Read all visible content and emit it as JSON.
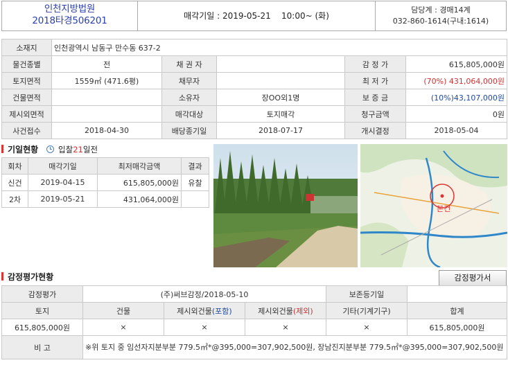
{
  "header": {
    "court": "인천지방법원",
    "case_no": "2018타경506201",
    "sale_label": "매각기일 :",
    "sale_date": "2019-05-21",
    "sale_time": "10:00~",
    "sale_day": "(화)",
    "department": "담당계 : 경매14계",
    "phone": "032-860-1614(구내:1614)"
  },
  "info": {
    "address_label": "소재지",
    "address": "인천광역시 남동구 만수동 637-2",
    "rows": [
      [
        "물건종별",
        "전",
        "채 권 자",
        "",
        "감 정 가",
        "615,805,000원"
      ],
      [
        "토지면적",
        "1559㎡ (471.6평)",
        "채무자",
        "",
        "최 저 가",
        "(70%) 431,064,000원"
      ],
      [
        "건물면적",
        "",
        "소유자",
        "장OO외1명",
        "보 증 금",
        "(10%)43,107,000원"
      ],
      [
        "제시외면적",
        "",
        "매각대상",
        "토지매각",
        "청구금액",
        "0원"
      ],
      [
        "사건접수",
        "2018-04-30",
        "배당종기일",
        "2018-07-17",
        "개시결정",
        "2018-05-04"
      ]
    ]
  },
  "history": {
    "title": "기일현황",
    "bid_prefix": "입찰",
    "bid_days": "21",
    "bid_suffix": "일전",
    "headers": [
      "회차",
      "매각기일",
      "최저매각금액",
      "결과"
    ],
    "rows": [
      [
        "신건",
        "2019-04-15",
        "615,805,000원",
        "유찰"
      ],
      [
        "2차",
        "2019-05-21",
        "431,064,000원",
        ""
      ]
    ]
  },
  "map": {
    "marker_label": "본건"
  },
  "appraisal": {
    "title": "감정평가현황",
    "button": "감정평가서",
    "label": "감정평가",
    "agency": "(주)써브감정/2018-05-10",
    "preserve_label": "보존등기일",
    "preserve_value": "",
    "headers": [
      "토지",
      "건물",
      "제시외건물",
      "(포함)",
      "제시외건물",
      "(제외)",
      "기타(기계기구)",
      "합계"
    ],
    "values": [
      "615,805,000원",
      "×",
      "×",
      "×",
      "×",
      "615,805,000원"
    ],
    "note_label": "비 고",
    "note": "※위 토지 중 임선자지분부분 779.5㎡*@395,000=307,902,500원, 장남진지분부분 779.5㎡*@395,000=307,902,500원"
  },
  "colors": {
    "red": "#cc3333",
    "blue": "#1f4aa0",
    "header_bg": "#ececec"
  }
}
